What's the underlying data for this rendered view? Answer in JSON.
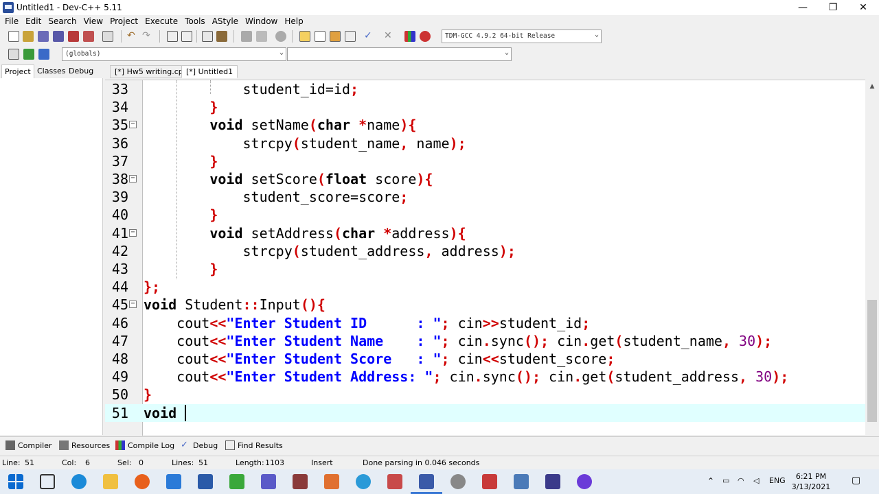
{
  "window": {
    "title": "Untitled1 - Dev-C++ 5.11",
    "minimize": "—",
    "restore": "❐",
    "close": "✕"
  },
  "menu": [
    "File",
    "Edit",
    "Search",
    "View",
    "Project",
    "Execute",
    "Tools",
    "AStyle",
    "Window",
    "Help"
  ],
  "toolbar": {
    "compiler_combo": "TDM-GCC 4.9.2 64-bit Release",
    "globals_combo": "(globals)",
    "members_combo": ""
  },
  "left_tabs": [
    "Project",
    "Classes",
    "Debug"
  ],
  "file_tabs": [
    "[*] Hw5 writing.cpp",
    "[*] Untitled1"
  ],
  "code_lines": [
    {
      "n": "33",
      "fold": false,
      "html": "            student_id=id<span class=\"sym\">;</span>"
    },
    {
      "n": "34",
      "fold": false,
      "html": "        <span class=\"sym\">}</span>"
    },
    {
      "n": "35",
      "fold": true,
      "html": "        <span class=\"kw\">void</span> setName<span class=\"sym\">(</span><span class=\"kw\">char</span> <span class=\"sym\">*</span>name<span class=\"sym\">){</span>"
    },
    {
      "n": "36",
      "fold": false,
      "html": "            strcpy<span class=\"sym\">(</span>student_name<span class=\"sym\">,</span> name<span class=\"sym\">);</span>"
    },
    {
      "n": "37",
      "fold": false,
      "html": "        <span class=\"sym\">}</span>"
    },
    {
      "n": "38",
      "fold": true,
      "html": "        <span class=\"kw\">void</span> setScore<span class=\"sym\">(</span><span class=\"kw\">float</span> score<span class=\"sym\">){</span>"
    },
    {
      "n": "39",
      "fold": false,
      "html": "            student_score=score<span class=\"sym\">;</span>"
    },
    {
      "n": "40",
      "fold": false,
      "html": "        <span class=\"sym\">}</span>"
    },
    {
      "n": "41",
      "fold": true,
      "html": "        <span class=\"kw\">void</span> setAddress<span class=\"sym\">(</span><span class=\"kw\">char</span> <span class=\"sym\">*</span>address<span class=\"sym\">){</span>"
    },
    {
      "n": "42",
      "fold": false,
      "html": "            strcpy<span class=\"sym\">(</span>student_address<span class=\"sym\">,</span> address<span class=\"sym\">);</span>"
    },
    {
      "n": "43",
      "fold": false,
      "html": "        <span class=\"sym\">}</span>"
    },
    {
      "n": "44",
      "fold": false,
      "html": "<span class=\"sym\">};</span>"
    },
    {
      "n": "45",
      "fold": true,
      "html": "<span class=\"kw\">void</span> Student<span class=\"sym\">::</span>Input<span class=\"sym\">(){</span>"
    },
    {
      "n": "46",
      "fold": false,
      "html": "    cout<span class=\"sym\">&lt;&lt;</span><span class=\"str\">\"Enter Student ID      : \"</span><span class=\"sym\">;</span> cin<span class=\"sym\">&gt;&gt;</span>student_id<span class=\"sym\">;</span>"
    },
    {
      "n": "47",
      "fold": false,
      "html": "    cout<span class=\"sym\">&lt;&lt;</span><span class=\"str\">\"Enter Student Name    : \"</span><span class=\"sym\">;</span> cin<span class=\"sym\">.</span>sync<span class=\"sym\">();</span> cin<span class=\"sym\">.</span>get<span class=\"sym\">(</span>student_name<span class=\"sym\">,</span> <span class=\"num\">30</span><span class=\"sym\">);</span>"
    },
    {
      "n": "48",
      "fold": false,
      "html": "    cout<span class=\"sym\">&lt;&lt;</span><span class=\"str\">\"Enter Student Score   : \"</span><span class=\"sym\">;</span> cin<span class=\"sym\">&lt;&lt;</span>student_score<span class=\"sym\">;</span>"
    },
    {
      "n": "49",
      "fold": false,
      "html": "    cout<span class=\"sym\">&lt;&lt;</span><span class=\"str\">\"Enter Student Address: \"</span><span class=\"sym\">;</span> cin<span class=\"sym\">.</span>sync<span class=\"sym\">();</span> cin<span class=\"sym\">.</span>get<span class=\"sym\">(</span>student_address<span class=\"sym\">,</span> <span class=\"num\">30</span><span class=\"sym\">);</span>"
    },
    {
      "n": "50",
      "fold": false,
      "html": "<span class=\"sym\">}</span>"
    },
    {
      "n": "51",
      "fold": false,
      "html": "<span class=\"kw\">void</span> <span style=\"border-left:2px solid #000\"> </span>"
    }
  ],
  "bottom_tabs": [
    "Compiler",
    "Resources",
    "Compile Log",
    "Debug",
    "Find Results"
  ],
  "status": {
    "line_label": "Line:",
    "line": "51",
    "col_label": "Col:",
    "col": "6",
    "sel_label": "Sel:",
    "sel": "0",
    "lines_label": "Lines:",
    "lines": "51",
    "length_label": "Length:",
    "length": "1103",
    "mode": "Insert",
    "message": "Done parsing in 0.046 seconds"
  },
  "taskbar": {
    "time": "6:21 PM",
    "date": "3/13/2021",
    "lang": "ENG"
  }
}
